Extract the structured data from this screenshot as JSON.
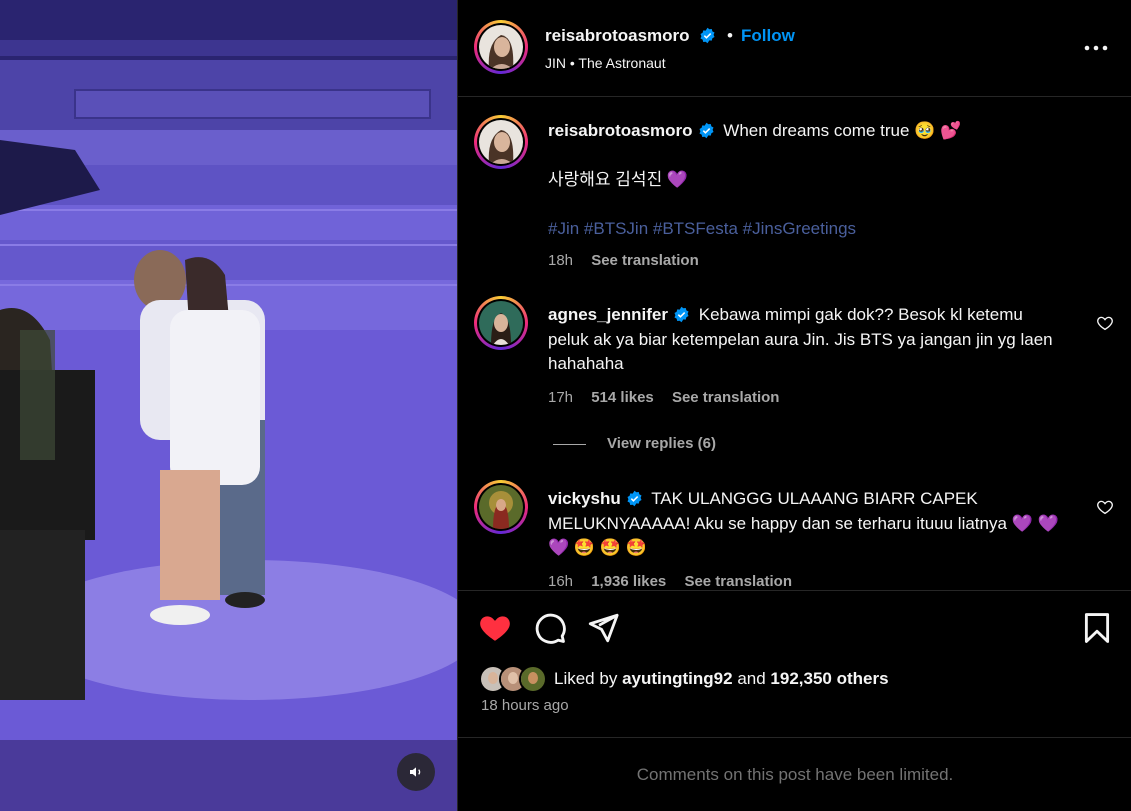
{
  "media": {
    "mute_icon": "speaker-icon"
  },
  "header": {
    "username": "reisabrotoasmoro",
    "verified_icon": "verified-badge-icon",
    "separator": "•",
    "follow_label": "Follow",
    "audio": "JIN • The Astronaut",
    "more_icon": "more-options-icon"
  },
  "caption": {
    "username": "reisabrotoasmoro",
    "text": "When dreams come true 🥹 💕",
    "line2": "사랑해요 김석진 💜",
    "hashtags": "#Jin #BTSJin #BTSFesta #JinsGreetings",
    "time": "18h",
    "see_translation": "See translation"
  },
  "comments": [
    {
      "username": "agnes_jennifer",
      "text": "Kebawa mimpi gak dok?? Besok kl ketemu peluk ak ya biar ketempelan aura Jin. Jis BTS ya jangan jin yg laen hahahaha",
      "time": "17h",
      "likes": "514 likes",
      "see_translation": "See translation",
      "view_replies": "View replies (6)"
    },
    {
      "username": "vickyshu",
      "text": "TAK ULANGGG ULAAANG BIARR CAPEK MELUKNYAAAAA! Aku se happy dan se terharu ituuu liatnya 💜 💜 💜 🤩 🤩 🤩",
      "time": "16h",
      "likes": "1,936 likes",
      "see_translation": "See translation"
    }
  ],
  "actions": {
    "like_icon": "heart-filled-icon",
    "comment_icon": "comment-icon",
    "share_icon": "share-icon",
    "save_icon": "bookmark-icon",
    "liked_by_prefix": "Liked by",
    "liked_by_user": "ayutingting92",
    "liked_by_and": "and",
    "liked_by_others": "192,350 others",
    "time_ago": "18 hours ago"
  },
  "footer": {
    "limited_text": "Comments on this post have been limited."
  },
  "colors": {
    "accent": "#0095f6",
    "like": "#ff3040",
    "hashtag": "#4a5f9c",
    "muted": "#a8a8a8"
  }
}
